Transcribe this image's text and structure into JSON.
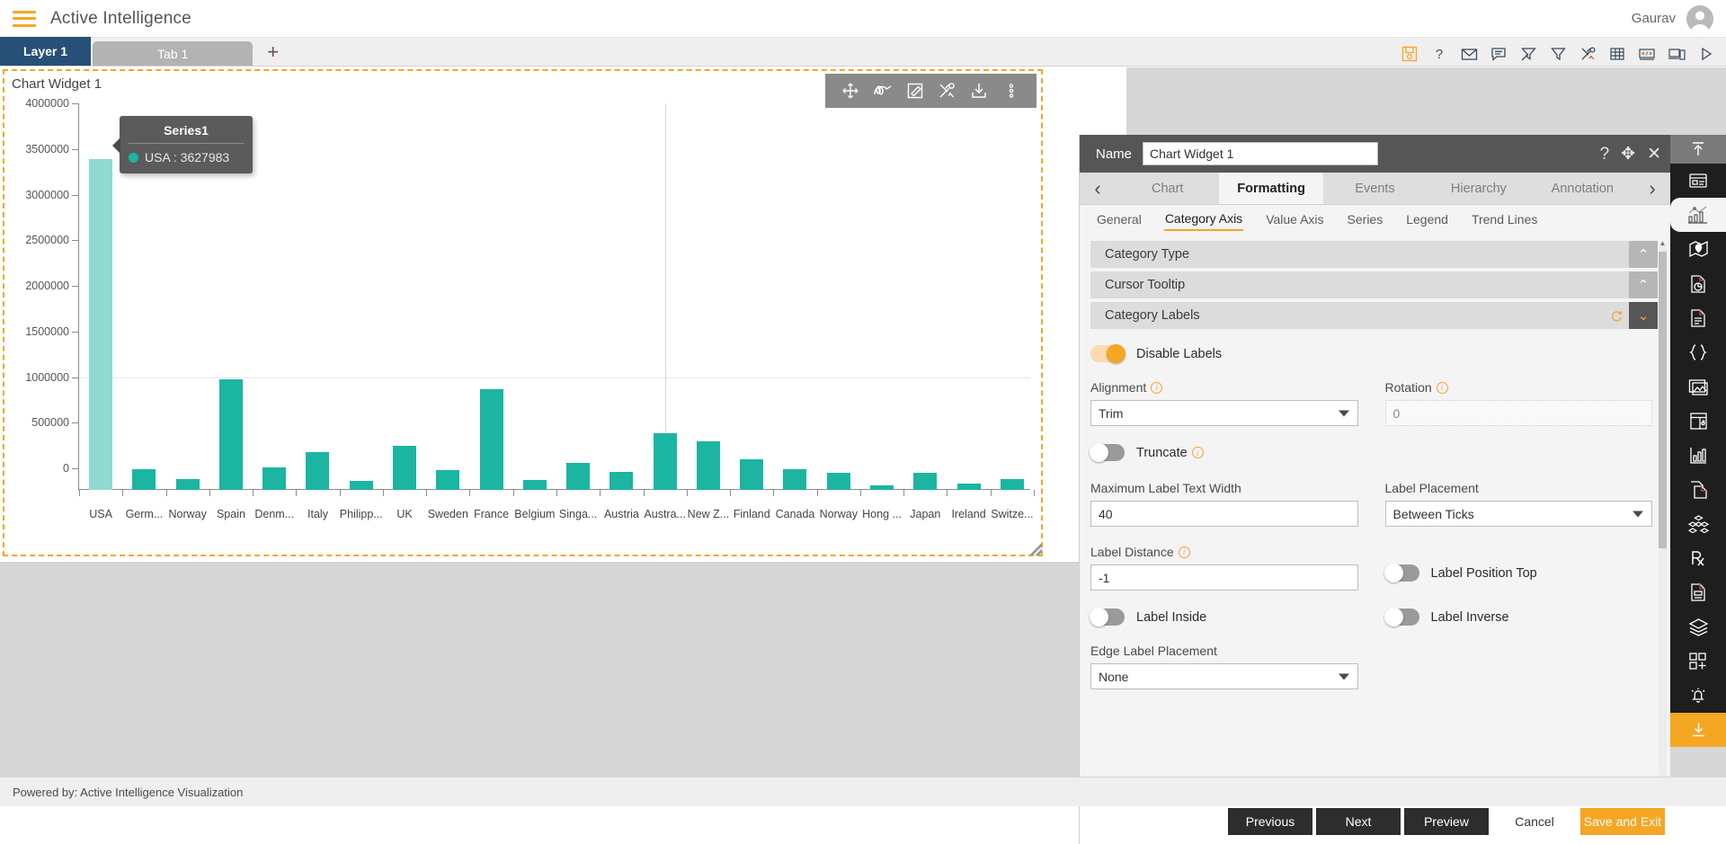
{
  "appbar": {
    "menu_icon": "hamburger-icon",
    "title": "Active Intelligence",
    "user_name": "Gaurav",
    "avatar_icon": "avatar-icon"
  },
  "tabstrip": {
    "layer_tab": "Layer 1",
    "tab1": "Tab 1",
    "add_tab": "+",
    "icons": [
      {
        "name": "save-icon"
      },
      {
        "name": "help-icon"
      },
      {
        "name": "mail-icon"
      },
      {
        "name": "comment-icon"
      },
      {
        "name": "clear-filter-icon"
      },
      {
        "name": "filter-icon"
      },
      {
        "name": "tools-icon"
      },
      {
        "name": "table-icon"
      },
      {
        "name": "code-icon"
      },
      {
        "name": "devices-icon"
      },
      {
        "name": "play-icon"
      }
    ]
  },
  "widget": {
    "title": "Chart Widget 1",
    "toolbar_icons": [
      {
        "name": "move-icon"
      },
      {
        "name": "scribble-icon"
      },
      {
        "name": "edit-icon"
      },
      {
        "name": "tools-icon"
      },
      {
        "name": "download-icon"
      },
      {
        "name": "more-options-icon"
      }
    ]
  },
  "chart_data": {
    "type": "bar",
    "title": "Chart Widget 1",
    "xlabel": "",
    "ylabel": "",
    "ylim": [
      0,
      4000000
    ],
    "ytick_values": [
      0,
      500000,
      1000000,
      1500000,
      2000000,
      2500000,
      3000000,
      3500000,
      4000000
    ],
    "ytick_labels": [
      "0",
      "500000",
      "1000000",
      "1500000",
      "2000000",
      "2500000",
      "3000000",
      "3500000",
      "4000000"
    ],
    "grid": true,
    "legend": false,
    "series": [
      {
        "name": "Series1",
        "color": "#1bb5a2",
        "highlight_color": "#8fd9d0",
        "values": [
          3627983,
          225000,
          122000,
          1208000,
          250000,
          412000,
          95000,
          480000,
          215000,
          1105000,
          105000,
          292000,
          197000,
          622000,
          530000,
          335000,
          222000,
          185000,
          48000,
          188000,
          72000,
          118000
        ]
      }
    ],
    "categories": [
      "USA",
      "Germ...",
      "Norway",
      "Spain",
      "Denm...",
      "Italy",
      "Philipp...",
      "UK",
      "Sweden",
      "France",
      "Belgium",
      "Singa...",
      "Austria",
      "Austra...",
      "New Z...",
      "Finland",
      "Canada",
      "Norway",
      "Hong ...",
      "Japan",
      "Ireland",
      "Switze..."
    ]
  },
  "tooltip": {
    "title": "Series1",
    "row_label": "USA",
    "row_value": "3627983",
    "row_text": "USA : 3627983"
  },
  "properties": {
    "name_label": "Name",
    "name_value": "Chart Widget 1",
    "head_icons": [
      {
        "name": "help-icon",
        "glyph": "?"
      },
      {
        "name": "move-icon",
        "glyph": "✥"
      },
      {
        "name": "close-icon",
        "glyph": "✕"
      }
    ],
    "tabs": [
      {
        "label": "Chart",
        "active": false
      },
      {
        "label": "Formatting",
        "active": true
      },
      {
        "label": "Events",
        "active": false
      },
      {
        "label": "Hierarchy",
        "active": false
      },
      {
        "label": "Annotation",
        "active": false
      }
    ],
    "prev_arrow": "‹",
    "next_arrow": "›",
    "subtabs": [
      {
        "label": "General",
        "active": false
      },
      {
        "label": "Category Axis",
        "active": true
      },
      {
        "label": "Value Axis",
        "active": false
      },
      {
        "label": "Series",
        "active": false
      },
      {
        "label": "Legend",
        "active": false
      },
      {
        "label": "Trend Lines",
        "active": false
      }
    ],
    "accordions": [
      {
        "label": "Category Type",
        "expanded": false
      },
      {
        "label": "Cursor Tooltip",
        "expanded": false
      },
      {
        "label": "Category Labels",
        "expanded": true
      }
    ],
    "fields": {
      "disable_labels_label": "Disable Labels",
      "disable_labels_on": true,
      "alignment_label": "Alignment",
      "alignment_value": "Trim",
      "rotation_label": "Rotation",
      "rotation_value": "0",
      "truncate_label": "Truncate",
      "truncate_on": false,
      "max_label_text_width_label": "Maximum Label Text Width",
      "max_label_text_width_value": "40",
      "label_placement_label": "Label Placement",
      "label_placement_value": "Between Ticks",
      "label_distance_label": "Label Distance",
      "label_distance_value": "-1",
      "label_position_top_label": "Label Position Top",
      "label_position_top_on": false,
      "label_inside_label": "Label Inside",
      "label_inside_on": false,
      "label_inverse_label": "Label Inverse",
      "label_inverse_on": false,
      "edge_label_placement_label": "Edge Label Placement",
      "edge_label_placement_value": "None"
    },
    "buttons": {
      "previous": "Previous",
      "next": "Next",
      "preview": "Preview",
      "cancel": "Cancel",
      "save_and_exit": "Save and Exit"
    }
  },
  "rail": {
    "top_icon": "collapse-up-icon",
    "items": [
      {
        "name": "widget-icon",
        "selected": false
      },
      {
        "name": "chart-icon",
        "selected": true
      },
      {
        "name": "map-icon",
        "selected": false
      },
      {
        "name": "report-pie-icon",
        "selected": false
      },
      {
        "name": "document-icon",
        "selected": false
      },
      {
        "name": "braces-icon",
        "selected": false
      },
      {
        "name": "image-icon",
        "selected": false
      },
      {
        "name": "layout-icon",
        "selected": false
      },
      {
        "name": "bar-stats-icon",
        "selected": false
      },
      {
        "name": "copy-page-icon",
        "selected": false
      },
      {
        "name": "cubes-icon",
        "selected": false
      },
      {
        "name": "prescription-icon",
        "selected": false
      },
      {
        "name": "form-document-icon",
        "selected": false
      },
      {
        "name": "layers-icon",
        "selected": false
      },
      {
        "name": "add-widget-icon",
        "selected": false
      },
      {
        "name": "alert-bell-icon",
        "selected": false
      },
      {
        "name": "download-icon",
        "selected": false,
        "amber": true
      }
    ]
  },
  "footer": {
    "text": "Powered by: Active Intelligence Visualization"
  },
  "colors": {
    "accent": "#f5a623",
    "series": "#1bb5a2",
    "series_highlight": "#8fd9d0",
    "layer_tab": "#265077",
    "panel_head": "#565656",
    "rail_bg": "#1e1e1e"
  }
}
